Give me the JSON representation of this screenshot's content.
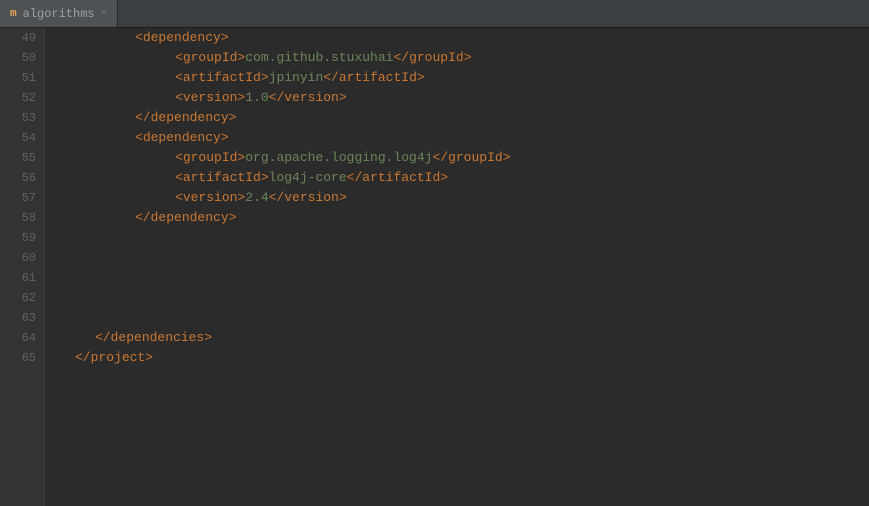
{
  "tab": {
    "icon": "m",
    "label": "algorithms",
    "close": "×"
  },
  "lines": [
    {
      "num": 49,
      "fold": false,
      "content": [
        {
          "type": "indent",
          "w": 80
        },
        {
          "type": "bracket",
          "t": "<"
        },
        {
          "type": "tag",
          "t": "dependency"
        },
        {
          "type": "bracket",
          "t": ">"
        }
      ]
    },
    {
      "num": 50,
      "fold": false,
      "content": [
        {
          "type": "indent",
          "w": 120
        },
        {
          "type": "bracket",
          "t": "<"
        },
        {
          "type": "tag",
          "t": "groupId"
        },
        {
          "type": "bracket",
          "t": ">"
        },
        {
          "type": "value",
          "t": "com.github.stuxuhai"
        },
        {
          "type": "bracket",
          "t": "</"
        },
        {
          "type": "tag",
          "t": "groupId"
        },
        {
          "type": "bracket",
          "t": ">"
        }
      ]
    },
    {
      "num": 51,
      "fold": false,
      "content": [
        {
          "type": "indent",
          "w": 120
        },
        {
          "type": "bracket",
          "t": "<"
        },
        {
          "type": "tag",
          "t": "artifactId"
        },
        {
          "type": "bracket",
          "t": ">"
        },
        {
          "type": "value",
          "t": "jpinyin"
        },
        {
          "type": "bracket",
          "t": "</"
        },
        {
          "type": "tag",
          "t": "artifactId"
        },
        {
          "type": "bracket",
          "t": ">"
        }
      ]
    },
    {
      "num": 52,
      "fold": false,
      "content": [
        {
          "type": "indent",
          "w": 120
        },
        {
          "type": "bracket",
          "t": "<"
        },
        {
          "type": "tag",
          "t": "version"
        },
        {
          "type": "bracket",
          "t": ">"
        },
        {
          "type": "value",
          "t": "1.0"
        },
        {
          "type": "bracket",
          "t": "</"
        },
        {
          "type": "tag",
          "t": "version"
        },
        {
          "type": "bracket",
          "t": ">"
        }
      ]
    },
    {
      "num": 53,
      "fold": true,
      "content": [
        {
          "type": "indent",
          "w": 80
        },
        {
          "type": "bracket",
          "t": "</"
        },
        {
          "type": "tag",
          "t": "dependency"
        },
        {
          "type": "bracket",
          "t": ">"
        }
      ]
    },
    {
      "num": 54,
      "fold": true,
      "content": [
        {
          "type": "indent",
          "w": 80
        },
        {
          "type": "bracket",
          "t": "<"
        },
        {
          "type": "tag",
          "t": "dependency"
        },
        {
          "type": "bracket",
          "t": ">"
        }
      ]
    },
    {
      "num": 55,
      "fold": false,
      "content": [
        {
          "type": "indent",
          "w": 120
        },
        {
          "type": "bracket",
          "t": "<"
        },
        {
          "type": "tag",
          "t": "groupId"
        },
        {
          "type": "bracket",
          "t": ">"
        },
        {
          "type": "value",
          "t": "org.apache.logging.log4j"
        },
        {
          "type": "bracket",
          "t": "</"
        },
        {
          "type": "tag",
          "t": "groupId"
        },
        {
          "type": "bracket",
          "t": ">"
        }
      ]
    },
    {
      "num": 56,
      "fold": false,
      "content": [
        {
          "type": "indent",
          "w": 120
        },
        {
          "type": "bracket",
          "t": "<"
        },
        {
          "type": "tag",
          "t": "artifactId"
        },
        {
          "type": "bracket",
          "t": ">"
        },
        {
          "type": "value",
          "t": "log4j-core"
        },
        {
          "type": "bracket",
          "t": "</"
        },
        {
          "type": "tag",
          "t": "artifactId"
        },
        {
          "type": "bracket",
          "t": ">"
        }
      ]
    },
    {
      "num": 57,
      "fold": false,
      "content": [
        {
          "type": "indent",
          "w": 120
        },
        {
          "type": "bracket",
          "t": "<"
        },
        {
          "type": "tag",
          "t": "version"
        },
        {
          "type": "bracket",
          "t": ">"
        },
        {
          "type": "value",
          "t": "2.4"
        },
        {
          "type": "bracket",
          "t": "</"
        },
        {
          "type": "tag",
          "t": "version"
        },
        {
          "type": "bracket",
          "t": ">"
        }
      ]
    },
    {
      "num": 58,
      "fold": true,
      "content": [
        {
          "type": "indent",
          "w": 80
        },
        {
          "type": "bracket",
          "t": "</"
        },
        {
          "type": "tag",
          "t": "dependency"
        },
        {
          "type": "bracket",
          "t": ">"
        }
      ]
    },
    {
      "num": 59,
      "fold": false,
      "content": []
    },
    {
      "num": 60,
      "fold": false,
      "content": []
    },
    {
      "num": 61,
      "fold": false,
      "content": []
    },
    {
      "num": 62,
      "fold": false,
      "content": []
    },
    {
      "num": 63,
      "fold": false,
      "content": []
    },
    {
      "num": 64,
      "fold": true,
      "content": [
        {
          "type": "indent",
          "w": 40
        },
        {
          "type": "bracket",
          "t": "</"
        },
        {
          "type": "tag",
          "t": "dependencies"
        },
        {
          "type": "bracket",
          "t": ">"
        }
      ]
    },
    {
      "num": 65,
      "fold": false,
      "content": [
        {
          "type": "indent",
          "w": 20
        },
        {
          "type": "bracket",
          "t": "</"
        },
        {
          "type": "tag",
          "t": "project"
        },
        {
          "type": "bracket",
          "t": ">"
        }
      ]
    }
  ]
}
